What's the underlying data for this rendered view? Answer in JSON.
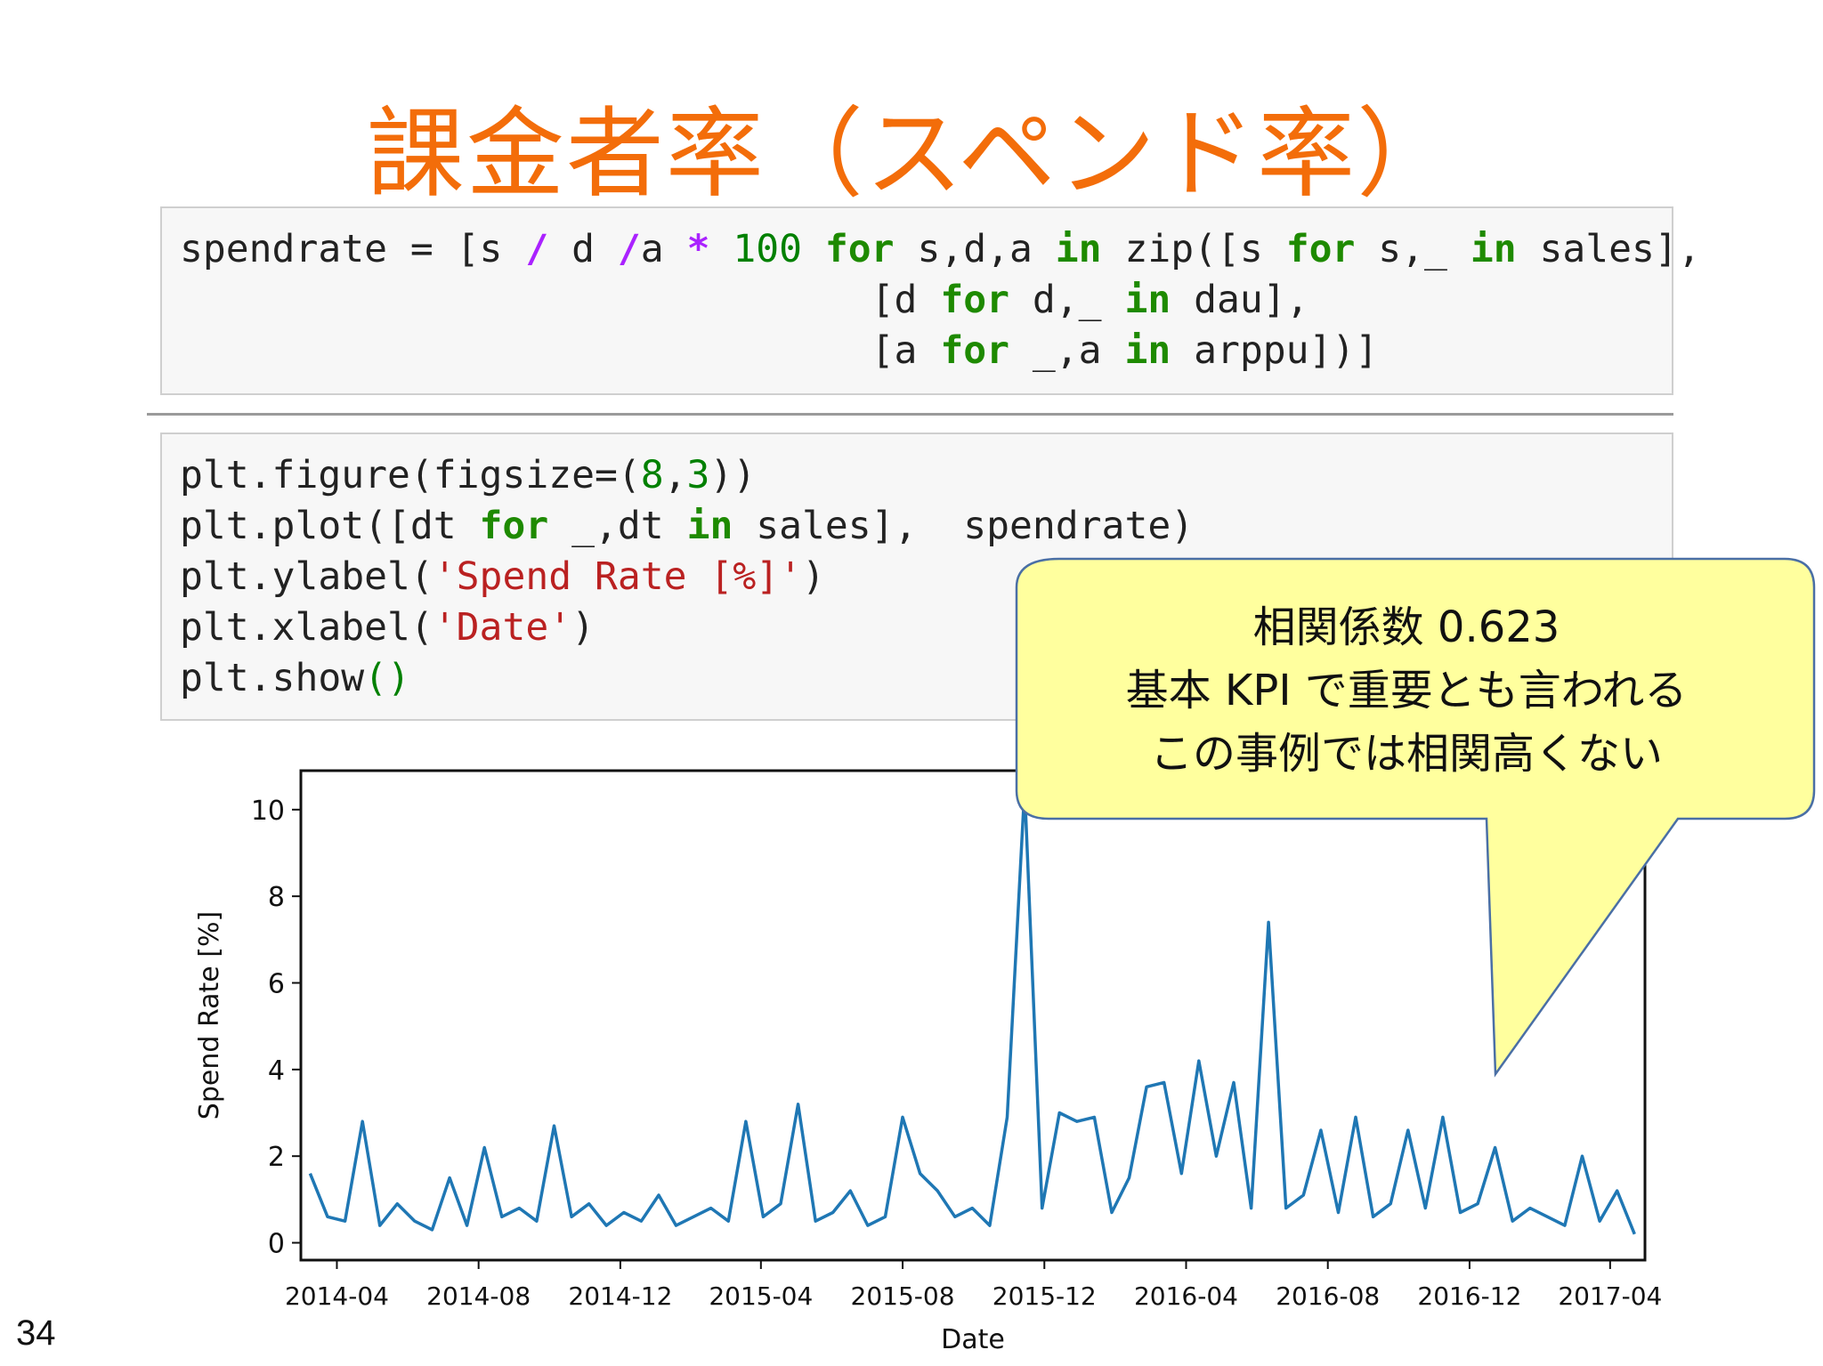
{
  "slide": {
    "title": "課金者率（スペンド率）",
    "page_number": "34"
  },
  "code_cells": {
    "cell1": {
      "line1": {
        "a": "spendrate = [s ",
        "op1": "/",
        "b": " d ",
        "op2": "/",
        "c": "a ",
        "op3": "*",
        "d": " ",
        "num": "100",
        "e": " ",
        "kw1": "for",
        "f": " s,d,a ",
        "kw2": "in",
        "g": " zip([s ",
        "kw3": "for",
        "h": " s,_ ",
        "kw4": "in",
        "i": " sales],"
      },
      "line2": {
        "a": "                              [d ",
        "kw1": "for",
        "b": " d,_ ",
        "kw2": "in",
        "c": " dau],"
      },
      "line3": {
        "a": "                              [a ",
        "kw1": "for",
        "b": " _,a ",
        "kw2": "in",
        "c": " arppu])]"
      }
    },
    "cell2": {
      "line1": {
        "a": "plt.figure(figsize=(",
        "n1": "8",
        "b": ",",
        "n2": "3",
        "c": "))"
      },
      "line2": {
        "a": "plt.plot([dt ",
        "kw1": "for",
        "b": " _,dt ",
        "kw2": "in",
        "c": " sales],  spendrate)"
      },
      "line3": {
        "a": "plt.ylabel(",
        "s": "'Spend Rate [%]'",
        "b": ")"
      },
      "line4": {
        "a": "plt.xlabel(",
        "s": "'Date'",
        "b": ")"
      },
      "line5": {
        "a": "plt.show",
        "p": "()"
      }
    }
  },
  "callout": {
    "line1": "相関係数 0.623",
    "line2": "基本 KPI で重要とも言われる",
    "line3": "この事例では相関高くない",
    "fill": "#ffff9e",
    "border": "#4a6fa5"
  },
  "chart_data": {
    "type": "line",
    "title": "",
    "xlabel": "Date",
    "ylabel": "Spend Rate [%]",
    "x_start": "2014-03-01",
    "x_end": "2017-05-01",
    "x_ticks": [
      "2014-04",
      "2014-08",
      "2014-12",
      "2015-04",
      "2015-08",
      "2015-12",
      "2016-04",
      "2016-08",
      "2016-12",
      "2017-04"
    ],
    "y_ticks": [
      "0",
      "2",
      "4",
      "6",
      "8",
      "10"
    ],
    "ylim": [
      -0.4,
      10.9
    ],
    "line_color": "#1f77b4",
    "series": [
      {
        "x": [
          "2014-03-09",
          "2014-03-24",
          "2014-04-08",
          "2014-04-23",
          "2014-05-08",
          "2014-05-23",
          "2014-06-07",
          "2014-06-22",
          "2014-07-07",
          "2014-07-22",
          "2014-08-06",
          "2014-08-21",
          "2014-09-05",
          "2014-09-20",
          "2014-10-05",
          "2014-10-20",
          "2014-11-04",
          "2014-11-19",
          "2014-12-04",
          "2014-12-19",
          "2015-01-03",
          "2015-01-18",
          "2015-02-02",
          "2015-02-17",
          "2015-03-04",
          "2015-03-19",
          "2015-04-03",
          "2015-04-18",
          "2015-05-03",
          "2015-05-18",
          "2015-06-02",
          "2015-06-17",
          "2015-07-02",
          "2015-07-17",
          "2015-08-01",
          "2015-08-16",
          "2015-08-31",
          "2015-09-15",
          "2015-09-30",
          "2015-10-15",
          "2015-10-30",
          "2015-11-14",
          "2015-11-29",
          "2015-12-14",
          "2015-12-29",
          "2016-01-13",
          "2016-01-28",
          "2016-02-12",
          "2016-02-27",
          "2016-03-13",
          "2016-03-28",
          "2016-04-12",
          "2016-04-27",
          "2016-05-12",
          "2016-05-27",
          "2016-06-11",
          "2016-06-26",
          "2016-07-11",
          "2016-07-26",
          "2016-08-10",
          "2016-08-25",
          "2016-09-09",
          "2016-09-24",
          "2016-10-09",
          "2016-10-24",
          "2016-11-08",
          "2016-11-23",
          "2016-12-08",
          "2016-12-23",
          "2017-01-07",
          "2017-01-22",
          "2017-02-06",
          "2017-02-21",
          "2017-03-08",
          "2017-03-23",
          "2017-04-07",
          "2017-04-22"
        ],
        "y": [
          1.6,
          0.6,
          0.5,
          2.8,
          0.4,
          0.9,
          0.5,
          0.3,
          1.5,
          0.4,
          2.2,
          0.6,
          0.8,
          0.5,
          2.7,
          0.6,
          0.9,
          0.4,
          0.7,
          0.5,
          1.1,
          0.4,
          0.6,
          0.8,
          0.5,
          2.8,
          0.6,
          0.9,
          3.2,
          0.5,
          0.7,
          1.2,
          0.4,
          0.6,
          2.9,
          1.6,
          1.2,
          0.6,
          0.8,
          0.4,
          2.9,
          10.5,
          0.8,
          3.0,
          2.8,
          2.9,
          0.7,
          1.5,
          3.6,
          3.7,
          1.6,
          4.2,
          2.0,
          3.7,
          0.8,
          7.4,
          0.8,
          1.1,
          2.6,
          0.7,
          2.9,
          0.6,
          0.9,
          2.6,
          0.8,
          2.9,
          0.7,
          0.9,
          2.2,
          0.5,
          0.8,
          0.6,
          0.4,
          2.0,
          0.5,
          1.2,
          0.2
        ]
      }
    ]
  }
}
